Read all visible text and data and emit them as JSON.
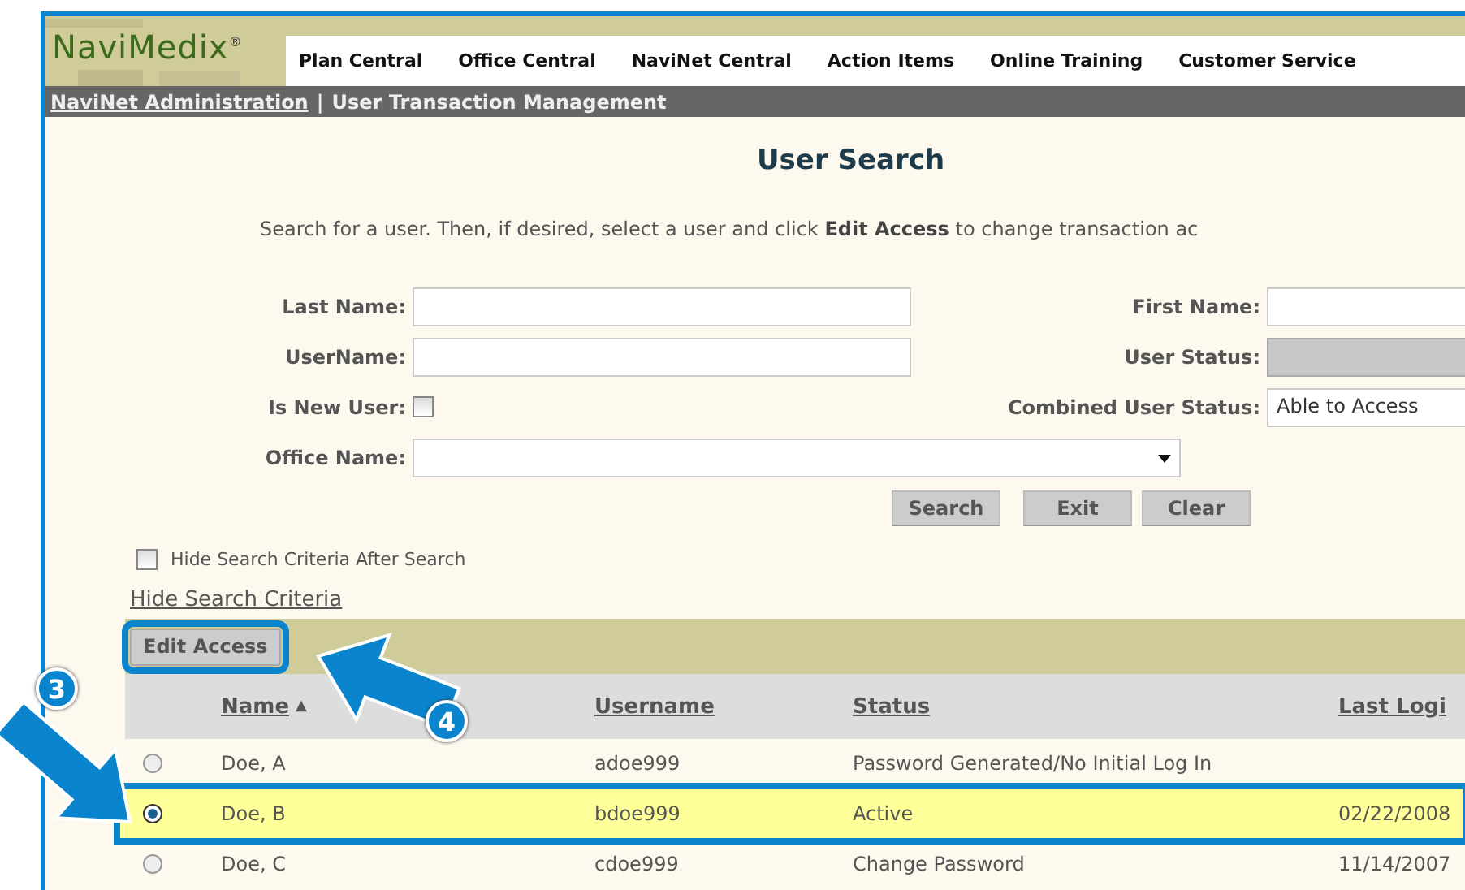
{
  "logo": {
    "text": "NaviMedix$^{®}$"
  },
  "nav": [
    {
      "label": "Plan Central"
    },
    {
      "label": "Office Central"
    },
    {
      "label": "NaviNet Central"
    },
    {
      "label": "Action Items"
    },
    {
      "label": "Online Training"
    },
    {
      "label": "Customer Service"
    }
  ],
  "breadcrumb": {
    "link": "NaviNet Administration",
    "separator": "|",
    "current": "User Transaction Management"
  },
  "title": "User Search",
  "instructions": "Search for a user. Then, if desired, select a user and click **Edit Access** to change transaction ac",
  "form": [
    {
      "kind": "text",
      "label": "Last Name:"
    },
    {
      "kind": "text",
      "label": "First Name:"
    },
    {
      "kind": "text",
      "label": "UserName:"
    },
    {
      "kind": "disabled",
      "label": "User Status:"
    },
    {
      "kind": "checkbox",
      "label": "Is New User:",
      "checked": false
    },
    {
      "kind": "text",
      "label": "Combined User Status:",
      "value": "Able to Access"
    },
    {
      "kind": "select",
      "label": "Office Name:"
    }
  ],
  "buttons": [
    {
      "label": "Search"
    },
    {
      "label": "Exit"
    },
    {
      "label": "Clear"
    }
  ],
  "hide_after_search": {
    "label": "Hide Search Criteria After Search",
    "checked": false
  },
  "hide_link": "Hide Search Criteria",
  "edit_access": {
    "label": "Edit Access",
    "highlighted": true
  },
  "table": {
    "columns": [
      {
        "label": "Name",
        "sort_indicator": "▲"
      },
      {
        "label": "Username"
      },
      {
        "label": "Status"
      },
      {
        "label": "Last Logi"
      }
    ],
    "rows": [
      {
        "name": "Doe, A",
        "username": "adoe999",
        "status": "Password Generated/No Initial Log In",
        "selected": false
      },
      {
        "name": "Doe, B",
        "username": "bdoe999",
        "status": "Active",
        "last_login": "02/22/2008",
        "selected": true
      },
      {
        "name": "Doe, C",
        "username": "cdoe999",
        "status": "Change Password",
        "last_login": "11/14/2007",
        "selected": false
      }
    ]
  },
  "callouts": [
    {
      "label": "3"
    },
    {
      "label": "4"
    }
  ]
}
